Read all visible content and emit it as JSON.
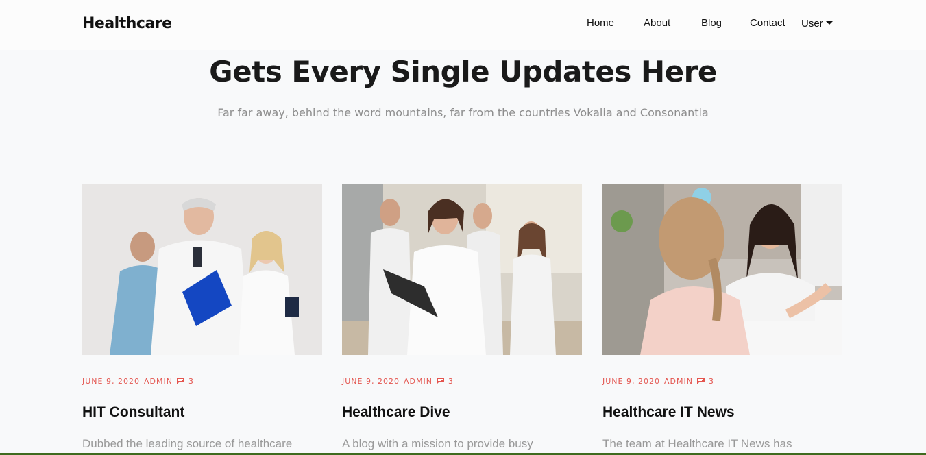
{
  "navbar": {
    "brand": "Healthcare",
    "items": [
      {
        "label": "Home"
      },
      {
        "label": "About"
      },
      {
        "label": "Blog"
      },
      {
        "label": "Contact"
      },
      {
        "label": "User"
      }
    ]
  },
  "hero": {
    "title": "Gets Every Single Updates Here",
    "subtitle": "Far far away, behind the word mountains, far from the countries Vokalia and Consonantia"
  },
  "cards": [
    {
      "date": "June 9, 2020",
      "author": "Admin",
      "comments": "3",
      "title": "HIT Consultant",
      "excerpt": "Dubbed the leading source of healthcare"
    },
    {
      "date": "June 9, 2020",
      "author": "Admin",
      "comments": "3",
      "title": "Healthcare Dive",
      "excerpt": "A blog with a mission to provide busy"
    },
    {
      "date": "June 9, 2020",
      "author": "Admin",
      "comments": "3",
      "title": "Healthcare IT News",
      "excerpt": "The team at Healthcare IT News has"
    }
  ],
  "icons": {
    "comment": "chat-bubble-icon",
    "user_dropdown": "caret-down-icon"
  },
  "colors": {
    "accent": "#e4554f",
    "background": "#f8f9fa",
    "navbar": "#fcfcfc"
  }
}
